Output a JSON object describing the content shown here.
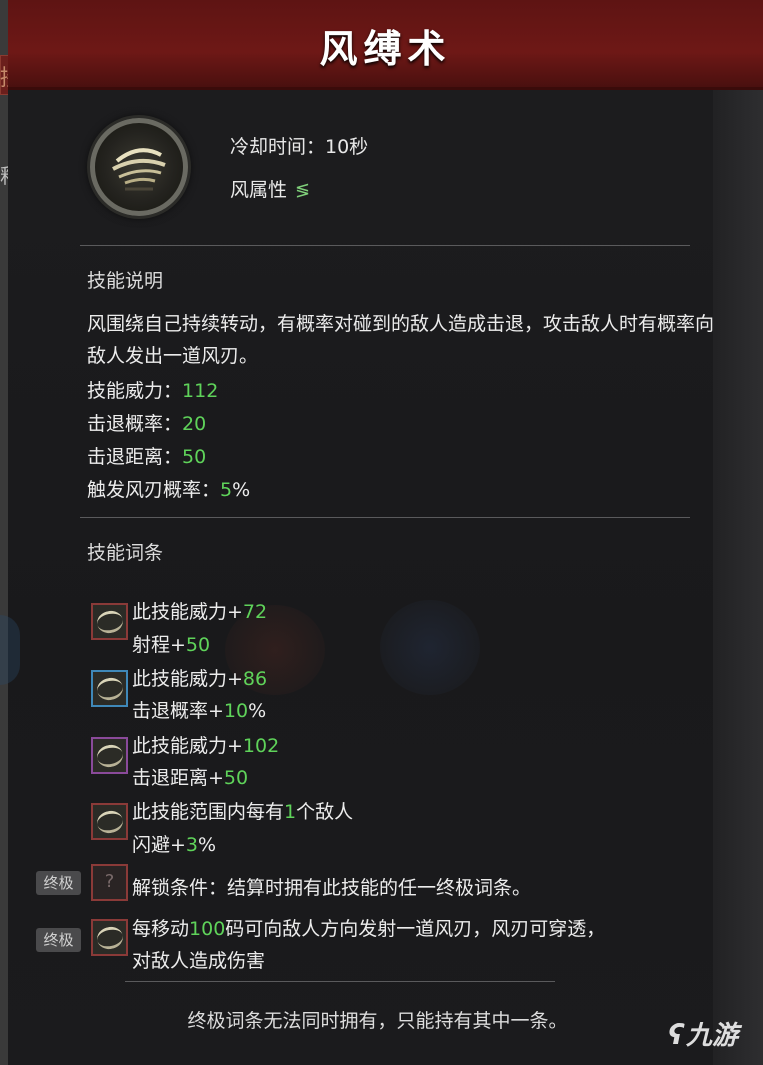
{
  "title": "风缚术",
  "background": {
    "left_tab_label": "接战",
    "left_side_text": "释放"
  },
  "skill": {
    "icon": "wind-swirl-icon",
    "cooldown": "冷却时间：10秒",
    "element_label": "风属性",
    "element_icon": "wind-element-icon"
  },
  "description": {
    "heading": "技能说明",
    "text": "风围绕自己持续转动，有概率对碰到的敌人造成击退，攻击敌人时有概率向敌人发出一道风刃。",
    "stats": [
      {
        "label": "技能威力：",
        "value": "112"
      },
      {
        "label": "击退概率：",
        "value": "20"
      },
      {
        "label": "击退距离：",
        "value": "50"
      },
      {
        "label": "触发风刃概率：",
        "value": "5",
        "suffix": "%"
      }
    ]
  },
  "affixes": {
    "heading": "技能词条",
    "items": [
      {
        "border": "red",
        "line1_label": "此技能威力+",
        "line1_value": "72",
        "line2_label": "射程+",
        "line2_value": "50",
        "line2_suffix": ""
      },
      {
        "border": "blue",
        "line1_label": "此技能威力+",
        "line1_value": "86",
        "line2_label": "击退概率+",
        "line2_value": "10",
        "line2_suffix": "%"
      },
      {
        "border": "purple",
        "line1_label": "此技能威力+",
        "line1_value": "102",
        "line2_label": "击退距离+",
        "line2_value": "50",
        "line2_suffix": ""
      },
      {
        "border": "red",
        "line1_pre": "此技能范围内每有",
        "line1_value": "1",
        "line1_post": "个敌人",
        "line2_label": "闪避+",
        "line2_value": "3",
        "line2_suffix": "%"
      }
    ],
    "ultimate_tag": "终极",
    "unlock_condition": "解锁条件：结算时拥有此技能的任一终极词条。",
    "ultimate": {
      "pre": "每移动",
      "value": "100",
      "post": "码可向敌人方向发射一道风刃，风刃可穿透，",
      "line2": "对敌人造成伤害"
    }
  },
  "footer": "终极词条无法同时拥有，只能持有其中一条。",
  "watermark": "九游",
  "colors": {
    "title_bar": "#6e1816",
    "value_green": "#5fd35a",
    "panel_bg": "#1b1b1d"
  }
}
